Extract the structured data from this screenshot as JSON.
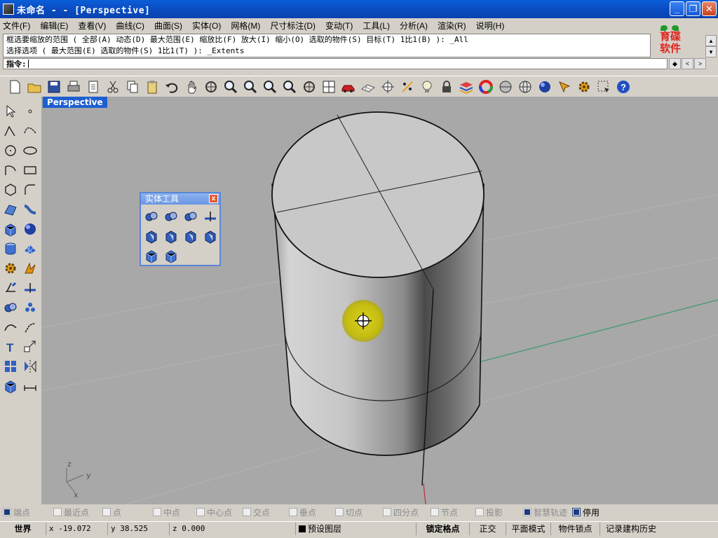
{
  "window": {
    "title": "未命名 - - [Perspective]",
    "minimize": "_",
    "restore": "❐",
    "close": "✕"
  },
  "menu": [
    "文件(F)",
    "编辑(E)",
    "查看(V)",
    "曲线(C)",
    "曲面(S)",
    "实体(O)",
    "网格(M)",
    "尺寸标注(D)",
    "变动(T)",
    "工具(L)",
    "分析(A)",
    "渲染(R)",
    "说明(H)"
  ],
  "logo": {
    "line1": "育碟",
    "line2": "软件"
  },
  "command": {
    "history": [
      "框选要缩放的范围 ( 全部(A) 动态(D) 最大范围(E) 缩放比(F) 放大(I) 缩小(O) 选取的物件(S) 目标(T) 1比1(B) ): _All",
      "选择选项 ( 最大范围(E) 选取的物件(S) 1比1(T) ): _Extents"
    ],
    "prompt_label": "指令:",
    "prompt_value": ""
  },
  "toolbar_icons": [
    "new-icon",
    "open-icon",
    "save-icon",
    "print-icon",
    "import-icon",
    "cut-icon",
    "copy-icon",
    "paste-icon",
    "undo-icon",
    "pan-icon",
    "rotate-view-icon",
    "zoom-icon",
    "zoom-window-icon",
    "zoom-extents-icon",
    "zoom-selected-icon",
    "rotate-icon",
    "four-views-icon",
    "car-icon",
    "grid-icon",
    "select-points-icon",
    "point-on-icon",
    "light-icon",
    "lock-icon",
    "layer-icon",
    "color-wheel-icon",
    "shaded-icon",
    "wireframe-sphere-icon",
    "render-sphere-icon",
    "move-icon",
    "settings-icon",
    "select-icon",
    "help-icon"
  ],
  "left_tools": [
    [
      "select-arrow-icon",
      "point-icon"
    ],
    [
      "polyline-icon",
      "curve-icon"
    ],
    [
      "circle-icon",
      "ellipse-icon"
    ],
    [
      "arc-icon",
      "rectangle-icon"
    ],
    [
      "polygon-icon",
      "fillet-curve-icon"
    ],
    [
      "surface-icon",
      "surface-edit-icon"
    ],
    [
      "box-solid-icon",
      "sphere-solid-icon"
    ],
    [
      "cylinder-icon",
      "mesh-icon"
    ],
    [
      "transform-gear-icon",
      "explode-icon"
    ],
    [
      "trim-icon",
      "split-icon"
    ],
    [
      "boolean-icon",
      "group-icon"
    ],
    [
      "blend-icon",
      "fillet-icon"
    ],
    [
      "text-icon",
      "scale-icon"
    ],
    [
      "array-icon",
      "mirror-icon"
    ],
    [
      "solid-box-icon",
      "dimension-icon"
    ]
  ],
  "viewport": {
    "label": "Perspective",
    "axis_z": "z",
    "axis_y": "y",
    "axis_x": "x"
  },
  "panel": {
    "title": "实体工具",
    "close": "x",
    "icons": [
      "boolean-union-icon",
      "boolean-difference-icon",
      "boolean-intersect-icon",
      "boolean-split-icon",
      "extract-surface-icon",
      "cap-holes-icon",
      "offset-surface-icon",
      "shell-solid-icon",
      "merge-faces-icon",
      "solid-edit-icon"
    ]
  },
  "osnaps": [
    {
      "label": "端点",
      "checked": true,
      "active": false
    },
    {
      "label": "最近点",
      "checked": false,
      "active": false
    },
    {
      "label": "点",
      "checked": false,
      "active": false
    },
    {
      "label": "中点",
      "checked": false,
      "active": false
    },
    {
      "label": "中心点",
      "checked": false,
      "active": false
    },
    {
      "label": "交点",
      "checked": false,
      "active": false
    },
    {
      "label": "垂点",
      "checked": false,
      "active": false
    },
    {
      "label": "切点",
      "checked": false,
      "active": false
    },
    {
      "label": "四分点",
      "checked": false,
      "active": false
    },
    {
      "label": "节点",
      "checked": false,
      "active": false
    },
    {
      "label": "投影",
      "checked": false,
      "active": false
    },
    {
      "label": "智慧轨迹",
      "checked": true,
      "active": false
    },
    {
      "label": "停用",
      "checked": true,
      "active": true
    }
  ],
  "status": {
    "cplane": "世界",
    "x": "x -19.072",
    "y": "y 38.525",
    "z": "z 0.000",
    "layer": "预设图层",
    "snap": "锁定格点",
    "ortho": "正交",
    "planar": "平面模式",
    "osnap": "物件锁点",
    "history": "记录建构历史"
  },
  "colors": {
    "viewport_bg": "#a8a8a8",
    "title_bar": "#0b4fc6",
    "viewport_tab": "#1e5fd0",
    "green_axis": "#3a9a6a"
  }
}
